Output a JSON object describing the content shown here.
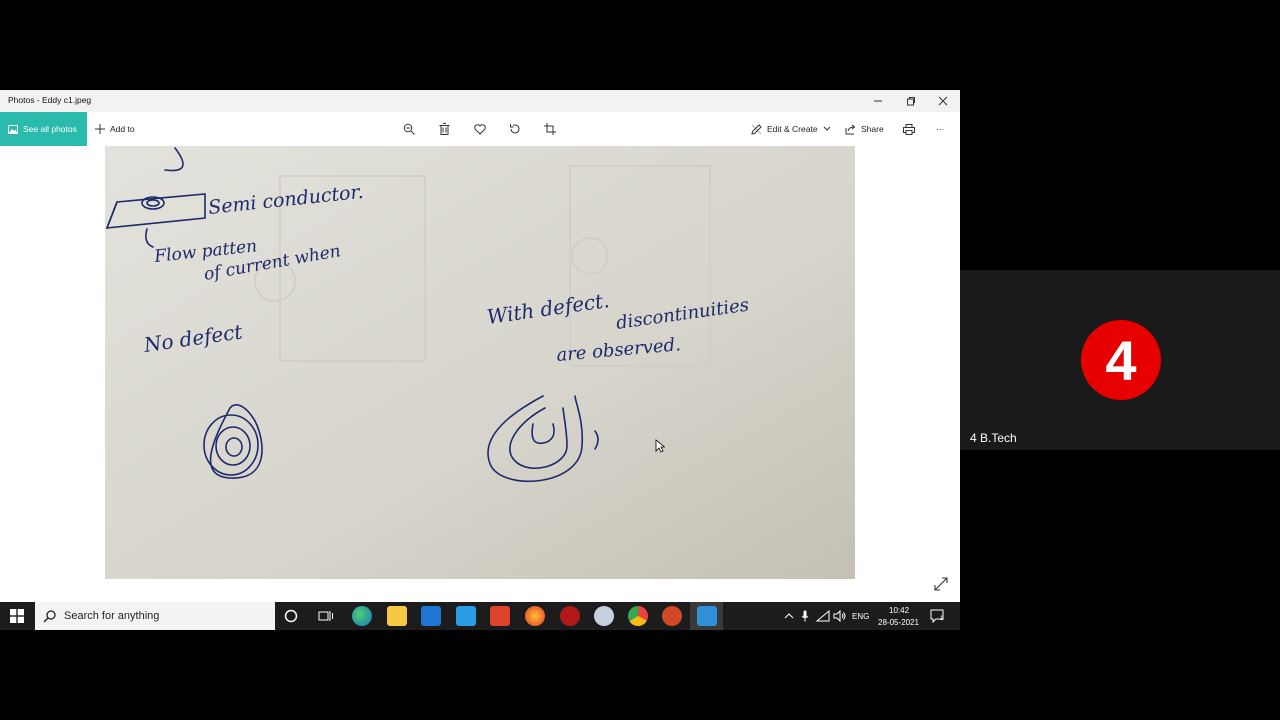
{
  "window": {
    "title": "Photos - Eddy c1.jpeg",
    "controls": [
      "minimize-icon",
      "restore-icon",
      "close-icon"
    ]
  },
  "toolbar": {
    "see_all_label": "See all photos",
    "add_to_label": "Add to",
    "center_tools": [
      "zoom-icon",
      "delete-icon",
      "favorite-icon",
      "rotate-icon",
      "crop-icon"
    ],
    "edit_create_label": "Edit & Create",
    "share_label": "Share",
    "more_label": "···"
  },
  "photo": {
    "handwritten_text": [
      "Semi conductor.",
      "Flow patten",
      "of current when",
      "No defect",
      "With defect.",
      "discontinuities",
      "are observed."
    ],
    "background_color": "#d9d7cf",
    "ink_color": "#1d2a6b"
  },
  "taskbar": {
    "search_placeholder": "Search for anything",
    "tray": {
      "language": "ENG",
      "time": "10:42",
      "date": "28-05-2021",
      "notifications": "1"
    },
    "pinned_apps": [
      "cortana-icon",
      "task-view-icon",
      "edge-icon",
      "file-explorer-icon",
      "store-icon",
      "mail-icon",
      "office-icon",
      "firefox-icon",
      "app-icon",
      "paint-icon",
      "chrome-icon",
      "powerpoint-icon",
      "photos-icon"
    ]
  },
  "participant": {
    "badge_number": "4",
    "badge_color": "#e60000",
    "name": "4 B.Tech"
  }
}
